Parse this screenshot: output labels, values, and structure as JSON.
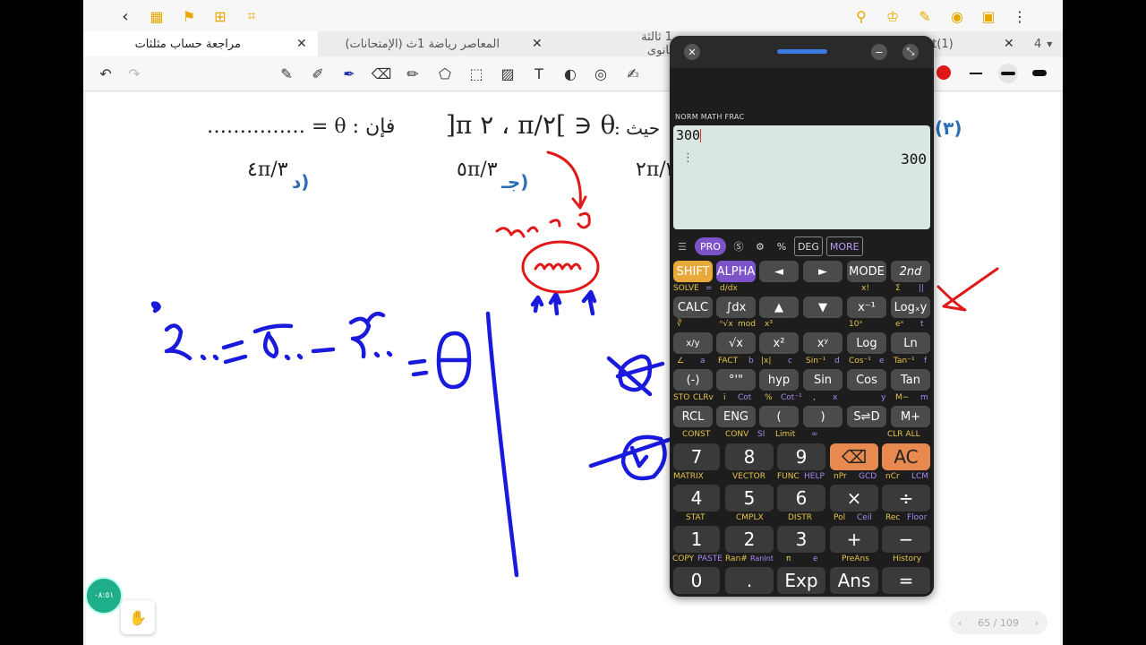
{
  "tabs": [
    {
      "label": "مراجعة حساب مثلثات",
      "active": true
    },
    {
      "label": "المعاصر رياضة 1ث (الإمتحانات)",
      "active": false
    },
    {
      "label": "1 ثالثة ثانوى",
      "active": false
    },
    {
      "label": "ent(1)",
      "active": false
    }
  ],
  "tab_count": "4",
  "document": {
    "question_line": "فإن : θ = …………… ، حيث : θ ∈ ]π/٢ ، ٢π[",
    "question_num": "(٣)",
    "answer_left": "فإن : θ = ……………",
    "answer_mid": "]π ٢ ، π/٢[ ∋ θ",
    "answer_right": "حيث :",
    "opt_d_label": "(د",
    "opt_d_value": "٤π/٣",
    "opt_c_label": "(جـ",
    "opt_c_value": "٥π/٣",
    "opt_b_value": "٢π/٣"
  },
  "timer": "٠٨:٥١",
  "pager": {
    "label": "65 / 109"
  },
  "calculator": {
    "modes": "NORM  MATH  FRAC",
    "input": "300",
    "result": "300",
    "status_items": [
      "PRO",
      "DEG",
      "MORE"
    ]
  },
  "keys": {
    "row1": [
      "SHIFT",
      "ALPHA",
      "◄",
      "►",
      "MODE",
      "2nd"
    ],
    "row2": [
      "CALC",
      "∫dx",
      "▲",
      "▼",
      "x⁻¹",
      "Logₓy"
    ],
    "row3": [
      "x/y",
      "√x",
      "x²",
      "xʸ",
      "Log",
      "Ln"
    ],
    "row4": [
      "(-)",
      "°'\"",
      "hyp",
      "Sin",
      "Cos",
      "Tan"
    ],
    "row5": [
      "RCL",
      "ENG",
      "(",
      ")",
      "S⇌D",
      "M+"
    ],
    "row6": [
      "7",
      "8",
      "9",
      "⌫",
      "AC"
    ],
    "row7": [
      "4",
      "5",
      "6",
      "×",
      "÷"
    ],
    "row8": [
      "1",
      "2",
      "3",
      "+",
      "−"
    ],
    "row9": [
      "0",
      ".",
      "Exp",
      "Ans",
      "="
    ]
  },
  "key_labels": {
    "l1": [
      "SOLVE",
      "=",
      "d/dx",
      "x!",
      "Σ",
      "||"
    ],
    "l2": [
      "∛",
      "ⁿ√x",
      "mod",
      "x³",
      "10ˣ",
      "eˣ",
      "t"
    ],
    "l3": [
      "∠",
      "a",
      "FACT",
      "b",
      "|x|",
      "c",
      "Sin⁻¹",
      "d",
      "Cos⁻¹",
      "e",
      "Tan⁻¹",
      "f"
    ],
    "l4": [
      "STO",
      "CLRv",
      "i",
      "Cot",
      "%",
      "Cot⁻¹",
      ",",
      "x",
      "y",
      "M−",
      "m"
    ],
    "l5": [
      "CONST",
      "CONV",
      "SI",
      "Limit",
      "∞",
      "CLR ALL"
    ],
    "l6": [
      "MATRIX",
      "VECTOR",
      "FUNC",
      "HELP",
      "nPr",
      "GCD",
      "nCr",
      "LCM"
    ],
    "l7": [
      "STAT",
      "CMPLX",
      "DISTR",
      "Pol",
      "Ceil",
      "Rec",
      "Floor"
    ],
    "l8": [
      "COPY",
      "PASTE",
      "Ran#",
      "RanInt",
      "π",
      "e",
      "PreAns",
      "History"
    ]
  },
  "colors": {
    "accent": "#e6a800",
    "ink_blue": "#1a1adc",
    "ink_red": "#e01818",
    "calc_bg": "#1d1d1d",
    "screen": "#d9e6e1"
  }
}
